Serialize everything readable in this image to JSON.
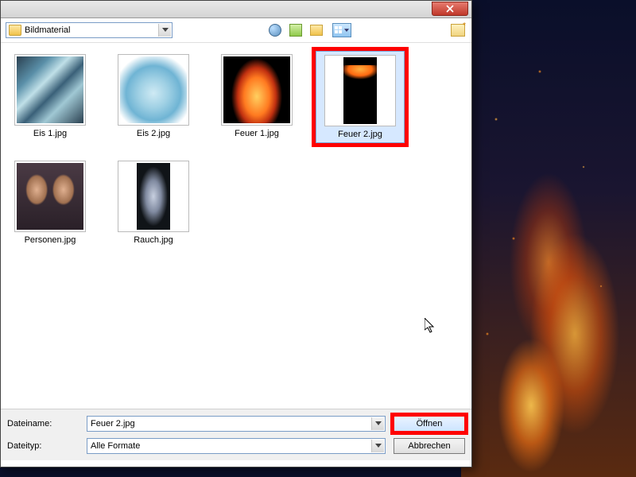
{
  "nav": {
    "folder_name": "Bildmaterial"
  },
  "files": [
    {
      "label": "Eis 1.jpg",
      "selected": false,
      "highlighted": false,
      "art": "art-ice1",
      "tall": false
    },
    {
      "label": "Eis 2.jpg",
      "selected": false,
      "highlighted": false,
      "art": "art-ice2",
      "tall": false
    },
    {
      "label": "Feuer 1.jpg",
      "selected": false,
      "highlighted": false,
      "art": "art-feuer1",
      "tall": false
    },
    {
      "label": "Feuer 2.jpg",
      "selected": true,
      "highlighted": true,
      "art": "art-feuer2",
      "tall": true
    },
    {
      "label": "Personen.jpg",
      "selected": false,
      "highlighted": false,
      "art": "art-person",
      "tall": false
    },
    {
      "label": "Rauch.jpg",
      "selected": false,
      "highlighted": false,
      "art": "art-rauch",
      "tall": true
    }
  ],
  "form": {
    "filename_label": "Dateiname:",
    "filetype_label": "Dateityp:",
    "filename_value": "Feuer 2.jpg",
    "filetype_value": "Alle Formate",
    "open_label": "Öffnen",
    "cancel_label": "Abbrechen"
  }
}
